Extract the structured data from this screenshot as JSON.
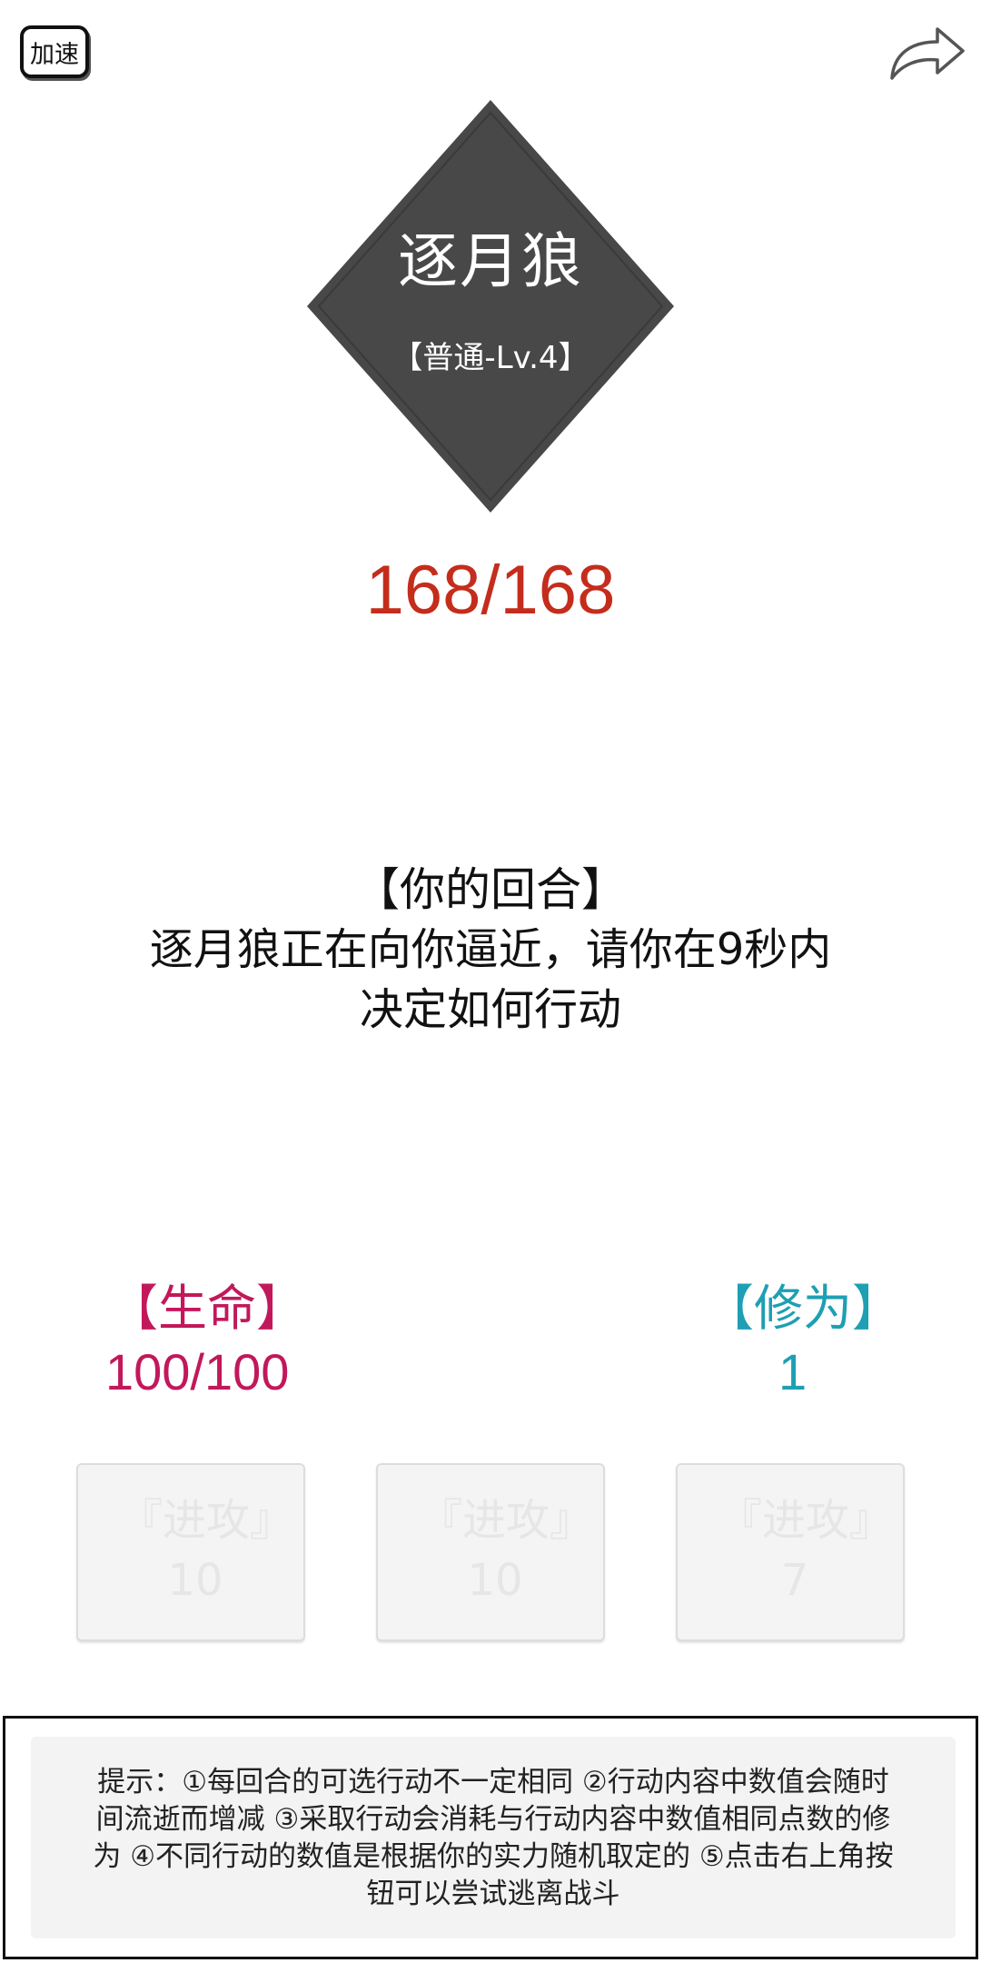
{
  "top_bar": {
    "speed_label": "加速",
    "share_icon": "share-arrow-icon"
  },
  "enemy": {
    "name": "逐月狼",
    "level": "【普通-Lv.4】",
    "hp": "168/168",
    "card_color": "#484848",
    "hp_color": "#c42d1c"
  },
  "message": {
    "title": "【你的回合】",
    "text": "逐月狼正在向你逼近，请你在9秒内决定如何行动"
  },
  "player": {
    "hp_label": "【生命】",
    "hp_value": "100/100",
    "hp_color": "#c2185b",
    "cultivation_label": "【修为】",
    "cultivation_value": "1",
    "cultivation_color": "#1e9fb3"
  },
  "actions": [
    {
      "label": "『进攻』10",
      "enabled": false
    },
    {
      "label": "『进攻』10",
      "enabled": false
    },
    {
      "label": "『进攻』7",
      "enabled": false
    }
  ],
  "tip": {
    "text": "提示：①每回合的可选行动不一定相同 ②行动内容中数值会随时间流逝而增减 ③采取行动会消耗与行动内容中数值相同点数的修为 ④不同行动的数值是根据你的实力随机取定的 ⑤点击右上角按钮可以尝试逃离战斗"
  }
}
